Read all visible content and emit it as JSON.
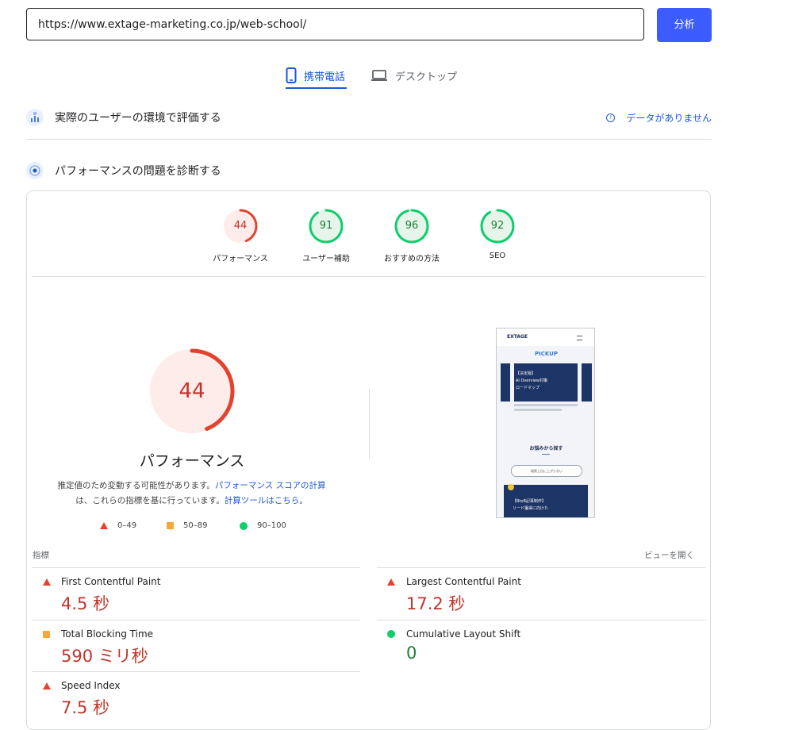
{
  "url_bar": {
    "value": "https://www.extage-marketing.co.jp/web-school/",
    "analyze_label": "分析"
  },
  "tabs": [
    {
      "label": "携帯電話",
      "icon": "smartphone-icon",
      "active": true
    },
    {
      "label": "デスクトップ",
      "icon": "laptop-icon",
      "active": false
    }
  ],
  "field_section": {
    "title": "実際のユーザーの環境で評価する",
    "no_data": "データがありません"
  },
  "lab_section": {
    "title": "パフォーマンスの問題を診断する"
  },
  "categories": [
    {
      "label": "パフォーマンス",
      "score": "44",
      "status": "fail"
    },
    {
      "label": "ユーザー補助",
      "score": "91",
      "status": "pass"
    },
    {
      "label": "おすすめの方法",
      "score": "96",
      "status": "pass"
    },
    {
      "label": "SEO",
      "score": "92",
      "status": "pass"
    }
  ],
  "performance": {
    "score": "44",
    "title": "パフォーマンス",
    "desc_1": "推定値のため変動する可能性があります。",
    "desc_link_1": "パフォーマンス スコアの計算",
    "desc_2": "は、これらの指標を基に行っています。",
    "desc_link_2": "計算ツールはこちら",
    "desc_end": "。"
  },
  "legend": [
    {
      "shape": "triangle",
      "range": "0–49"
    },
    {
      "shape": "square",
      "range": "50–89"
    },
    {
      "shape": "circle",
      "range": "90–100"
    }
  ],
  "thumbnail": {
    "logo": "EXTAGE",
    "pickup": "PICKUP",
    "card_tag": "【決定版】",
    "card_line1": "AI Overview対策",
    "card_line2": "ロードマップ",
    "section_heading": "お悩みから探す",
    "select_text": "検索上位に上がらない",
    "bottom_tag": "【BtoB記事制作】",
    "bottom_line": "リード獲得に向けた"
  },
  "metrics_header": {
    "label": "指標",
    "expand": "ビューを開く"
  },
  "metrics": [
    {
      "name": "First Contentful Paint",
      "value": "4.5 秒",
      "rating": "fail"
    },
    {
      "name": "Largest Contentful Paint",
      "value": "17.2 秒",
      "rating": "fail"
    },
    {
      "name": "Total Blocking Time",
      "value": "590 ミリ秒",
      "rating": "average"
    },
    {
      "name": "Cumulative Layout Shift",
      "value": "0",
      "rating": "pass"
    },
    {
      "name": "Speed Index",
      "value": "7.5 秒",
      "rating": "fail"
    }
  ],
  "colors": {
    "accent": "#1a57d6",
    "button": "#3c5cff",
    "fail": "#e2432f",
    "average": "#f4a93b",
    "pass": "#0cce6b"
  }
}
